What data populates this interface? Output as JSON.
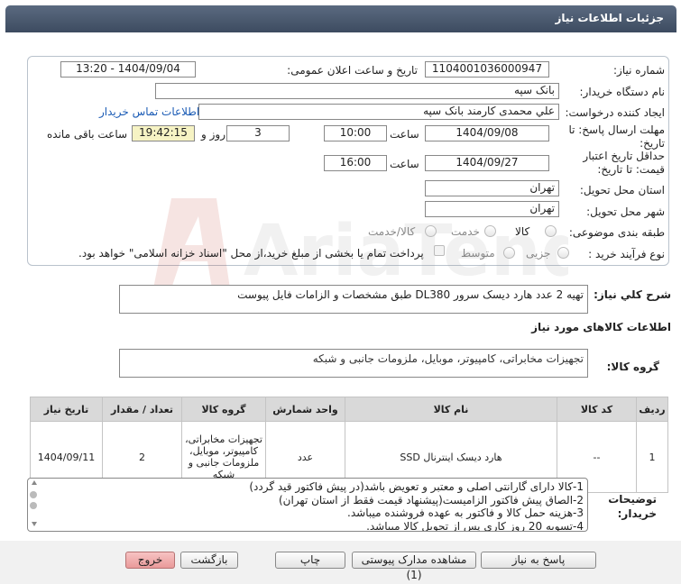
{
  "header": {
    "title": "جزئیات اطلاعات نیاز"
  },
  "form": {
    "need_number_label": "شماره نیاز:",
    "need_number": "1104001036000947",
    "announce_label": "تاریخ و ساعت اعلان عمومی:",
    "announce_value": "1404/09/04 - 13:20",
    "buyer_org_label": "نام دستگاه خریدار:",
    "buyer_org": "بانک سپه",
    "creator_label": "ایجاد کننده درخواست:",
    "creator": "علي محمدی كارمند بانک سپه",
    "contact_link": "اطلاعات تماس خریدار",
    "deadline_label_1": "مهلت ارسال پاسخ: تا",
    "deadline_label_2": "تاریخ:",
    "deadline_date": "1404/09/08",
    "time_label": "ساعت",
    "deadline_time": "10:00",
    "days": "3",
    "days_label": "روز و",
    "remaining_time": "19:42:15",
    "remaining_label": "ساعت باقی مانده",
    "validity_label_1": "حداقل تاریخ اعتبار",
    "validity_label_2": "قیمت: تا تاریخ:",
    "validity_date": "1404/09/27",
    "validity_time": "16:00",
    "province_label": "استان محل تحویل:",
    "province": "تهران",
    "city_label": "شهر محل تحویل:",
    "city": "تهران",
    "category_label": "طبقه بندی موضوعی:",
    "category_options": [
      "کالا",
      "خدمت",
      "کالا/خدمت"
    ],
    "process_label": "نوع فرآیند خرید :",
    "process_options": [
      "جزیی",
      "متوسط"
    ],
    "payment_note": "پرداخت تمام یا بخشی از مبلغ خرید،از محل \"اسناد خزانه اسلامی\" خواهد بود."
  },
  "summary": {
    "label": "شرح کلي نياز:",
    "text": "تهیه 2 عدد هارد دیسک سرور DL380 طبق مشخصات و الزامات فایل پیوست"
  },
  "goods": {
    "section_title": "اطلاعات کالاهای مورد نياز",
    "group_label": "گروه کالا:",
    "group_value": "تجهیزات مخابراتی، کامپیوتر، موبایل، ملزومات جانبی و شبکه",
    "columns": [
      "ردیف",
      "کد کالا",
      "نام کالا",
      "واحد شمارش",
      "گروه کالا",
      "تعداد / مقدار",
      "تاریخ نیاز"
    ],
    "rows": [
      {
        "row": "1",
        "code": "--",
        "name": "هارد دیسک اینترنال SSD",
        "unit": "عدد",
        "group_lines": [
          "تجهیزات مخابراتی،",
          "کامپیوتر، موبایل،",
          "ملزومات جانبی و",
          "شبکه"
        ],
        "qty": "2",
        "date": "1404/09/11"
      }
    ]
  },
  "buyer_notes": {
    "label_1": "توضیحات",
    "label_2": "خریدار:",
    "lines": [
      "1-کالا دارای گارانتی اصلی و  معتبر و تعویض باشد(در پیش فاکتور قید گردد)",
      "2-الصاق پیش فاکتور الزامیست(پیشنهاد قیمت فقط از استان تهران)",
      "3-هزینه حمل کالا و فاکتور به عهده فروشنده میباشد.",
      "4-تسویه 20 روز کاری پس از تحویل کالا میباشد."
    ]
  },
  "buttons": {
    "reply": "پاسخ به نیاز",
    "attachments": "مشاهده مدارک پیوستی (1)",
    "print": "چاپ",
    "back": "بازگشت",
    "exit": "خروج"
  },
  "watermark": {
    "text": "AriaTender.net"
  },
  "colors": {
    "header": "#4a586e",
    "yellow_field": "#f6f3c4",
    "link": "#1a5bb5",
    "red_button": "#eeaaaa"
  }
}
